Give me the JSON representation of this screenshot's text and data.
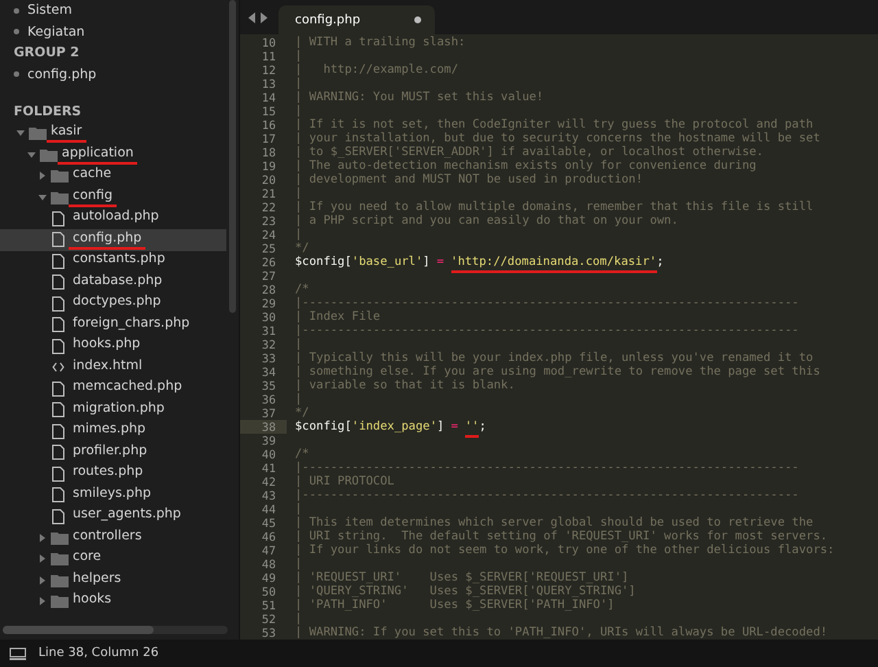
{
  "open_files": [
    {
      "kind": "item",
      "label": "Sistem"
    },
    {
      "kind": "item",
      "label": "Kegiatan"
    },
    {
      "kind": "header",
      "label": "GROUP 2"
    },
    {
      "kind": "item",
      "label": "config.php"
    }
  ],
  "folders": {
    "title": "FOLDERS",
    "tree": [
      {
        "kind": "folder",
        "label": "kasir",
        "expanded": true,
        "underlined": true,
        "selected": false,
        "children": [
          {
            "kind": "folder",
            "label": "application",
            "expanded": true,
            "underlined": true,
            "selected": false,
            "children": [
              {
                "kind": "folder",
                "label": "cache",
                "expanded": false,
                "underlined": false,
                "selected": false
              },
              {
                "kind": "folder",
                "label": "config",
                "expanded": true,
                "underlined": true,
                "selected": false,
                "children": [
                  {
                    "kind": "file",
                    "label": "autoload.php",
                    "underlined": false,
                    "selected": false
                  },
                  {
                    "kind": "file",
                    "label": "config.php",
                    "underlined": true,
                    "selected": true
                  },
                  {
                    "kind": "file",
                    "label": "constants.php",
                    "underlined": false,
                    "selected": false
                  },
                  {
                    "kind": "file",
                    "label": "database.php",
                    "underlined": false,
                    "selected": false
                  },
                  {
                    "kind": "file",
                    "label": "doctypes.php",
                    "underlined": false,
                    "selected": false
                  },
                  {
                    "kind": "file",
                    "label": "foreign_chars.php",
                    "underlined": false,
                    "selected": false
                  },
                  {
                    "kind": "file",
                    "label": "hooks.php",
                    "underlined": false,
                    "selected": false
                  },
                  {
                    "kind": "markup",
                    "label": "index.html",
                    "underlined": false,
                    "selected": false
                  },
                  {
                    "kind": "file",
                    "label": "memcached.php",
                    "underlined": false,
                    "selected": false
                  },
                  {
                    "kind": "file",
                    "label": "migration.php",
                    "underlined": false,
                    "selected": false
                  },
                  {
                    "kind": "file",
                    "label": "mimes.php",
                    "underlined": false,
                    "selected": false
                  },
                  {
                    "kind": "file",
                    "label": "profiler.php",
                    "underlined": false,
                    "selected": false
                  },
                  {
                    "kind": "file",
                    "label": "routes.php",
                    "underlined": false,
                    "selected": false
                  },
                  {
                    "kind": "file",
                    "label": "smileys.php",
                    "underlined": false,
                    "selected": false
                  },
                  {
                    "kind": "file",
                    "label": "user_agents.php",
                    "underlined": false,
                    "selected": false
                  }
                ]
              },
              {
                "kind": "folder",
                "label": "controllers",
                "expanded": false,
                "underlined": false,
                "selected": false
              },
              {
                "kind": "folder",
                "label": "core",
                "expanded": false,
                "underlined": false,
                "selected": false
              },
              {
                "kind": "folder",
                "label": "helpers",
                "expanded": false,
                "underlined": false,
                "selected": false
              },
              {
                "kind": "folder",
                "label": "hooks",
                "expanded": false,
                "underlined": false,
                "selected": false
              }
            ]
          }
        ]
      }
    ]
  },
  "tab": {
    "label": "config.php",
    "modified": true
  },
  "editor": {
    "lines": [
      {
        "number": "10",
        "current": false,
        "tokens": [
          {
            "kind": "comment",
            "text": "| WITH a trailing slash:"
          }
        ]
      },
      {
        "number": "11",
        "current": false,
        "tokens": [
          {
            "kind": "comment",
            "text": "|"
          }
        ]
      },
      {
        "number": "12",
        "current": false,
        "tokens": [
          {
            "kind": "comment",
            "text": "|   http://example.com/"
          }
        ]
      },
      {
        "number": "13",
        "current": false,
        "tokens": [
          {
            "kind": "comment",
            "text": "|"
          }
        ]
      },
      {
        "number": "14",
        "current": false,
        "tokens": [
          {
            "kind": "comment",
            "text": "| WARNING: You MUST set this value!"
          }
        ]
      },
      {
        "number": "15",
        "current": false,
        "tokens": [
          {
            "kind": "comment",
            "text": "|"
          }
        ]
      },
      {
        "number": "16",
        "current": false,
        "tokens": [
          {
            "kind": "comment",
            "text": "| If it is not set, then CodeIgniter will try guess the protocol and path"
          }
        ]
      },
      {
        "number": "17",
        "current": false,
        "tokens": [
          {
            "kind": "comment",
            "text": "| your installation, but due to security concerns the hostname will be set"
          }
        ]
      },
      {
        "number": "18",
        "current": false,
        "tokens": [
          {
            "kind": "comment",
            "text": "| to $_SERVER['SERVER_ADDR'] if available, or localhost otherwise."
          }
        ]
      },
      {
        "number": "19",
        "current": false,
        "tokens": [
          {
            "kind": "comment",
            "text": "| The auto-detection mechanism exists only for convenience during"
          }
        ]
      },
      {
        "number": "20",
        "current": false,
        "tokens": [
          {
            "kind": "comment",
            "text": "| development and MUST NOT be used in production!"
          }
        ]
      },
      {
        "number": "21",
        "current": false,
        "tokens": [
          {
            "kind": "comment",
            "text": "|"
          }
        ]
      },
      {
        "number": "22",
        "current": false,
        "tokens": [
          {
            "kind": "comment",
            "text": "| If you need to allow multiple domains, remember that this file is still"
          }
        ]
      },
      {
        "number": "23",
        "current": false,
        "tokens": [
          {
            "kind": "comment",
            "text": "| a PHP script and you can easily do that on your own."
          }
        ]
      },
      {
        "number": "24",
        "current": false,
        "tokens": [
          {
            "kind": "comment",
            "text": "|"
          }
        ]
      },
      {
        "number": "25",
        "current": false,
        "tokens": [
          {
            "kind": "comment",
            "text": "*/"
          }
        ]
      },
      {
        "number": "26",
        "current": false,
        "tokens": [
          {
            "kind": "variable",
            "text": "$config",
            "underlined": false
          },
          {
            "kind": "plain",
            "text": "[",
            "underlined": false
          },
          {
            "kind": "string",
            "text": "'base_url'",
            "underlined": false
          },
          {
            "kind": "plain",
            "text": "]",
            "underlined": false
          },
          {
            "kind": "operator",
            "text": "=",
            "underlined": false
          },
          {
            "kind": "string",
            "text": "'http://domainanda.com/kasir'",
            "underlined": true
          },
          {
            "kind": "plain",
            "text": ";",
            "underlined": false
          }
        ]
      },
      {
        "number": "27",
        "current": false
      },
      {
        "number": "28",
        "current": false,
        "tokens": [
          {
            "kind": "comment",
            "text": "/*"
          }
        ]
      },
      {
        "number": "29",
        "current": false,
        "tokens": [
          {
            "kind": "comment",
            "text": "|----------------------------------------------------------------------"
          }
        ]
      },
      {
        "number": "30",
        "current": false,
        "tokens": [
          {
            "kind": "comment",
            "text": "| Index File"
          }
        ]
      },
      {
        "number": "31",
        "current": false,
        "tokens": [
          {
            "kind": "comment",
            "text": "|----------------------------------------------------------------------"
          }
        ]
      },
      {
        "number": "32",
        "current": false,
        "tokens": [
          {
            "kind": "comment",
            "text": "|"
          }
        ]
      },
      {
        "number": "33",
        "current": false,
        "tokens": [
          {
            "kind": "comment",
            "text": "| Typically this will be your index.php file, unless you've renamed it to"
          }
        ]
      },
      {
        "number": "34",
        "current": false,
        "tokens": [
          {
            "kind": "comment",
            "text": "| something else. If you are using mod_rewrite to remove the page set this"
          }
        ]
      },
      {
        "number": "35",
        "current": false,
        "tokens": [
          {
            "kind": "comment",
            "text": "| variable so that it is blank."
          }
        ]
      },
      {
        "number": "36",
        "current": false,
        "tokens": [
          {
            "kind": "comment",
            "text": "|"
          }
        ]
      },
      {
        "number": "37",
        "current": false,
        "tokens": [
          {
            "kind": "comment",
            "text": "*/"
          }
        ]
      },
      {
        "number": "38",
        "current": true,
        "tokens": [
          {
            "kind": "variable",
            "text": "$config",
            "underlined": false
          },
          {
            "kind": "plain",
            "text": "[",
            "underlined": false
          },
          {
            "kind": "string",
            "text": "'index_page'",
            "underlined": false
          },
          {
            "kind": "plain",
            "text": "]",
            "underlined": false
          },
          {
            "kind": "operator",
            "text": "=",
            "underlined": false
          },
          {
            "kind": "string",
            "text": "''",
            "underlined": true
          },
          {
            "kind": "plain",
            "text": ";",
            "underlined": false
          }
        ]
      },
      {
        "number": "39",
        "current": false
      },
      {
        "number": "40",
        "current": false,
        "tokens": [
          {
            "kind": "comment",
            "text": "/*"
          }
        ]
      },
      {
        "number": "41",
        "current": false,
        "tokens": [
          {
            "kind": "comment",
            "text": "|----------------------------------------------------------------------"
          }
        ]
      },
      {
        "number": "42",
        "current": false,
        "tokens": [
          {
            "kind": "comment",
            "text": "| URI PROTOCOL"
          }
        ]
      },
      {
        "number": "43",
        "current": false,
        "tokens": [
          {
            "kind": "comment",
            "text": "|----------------------------------------------------------------------"
          }
        ]
      },
      {
        "number": "44",
        "current": false,
        "tokens": [
          {
            "kind": "comment",
            "text": "|"
          }
        ]
      },
      {
        "number": "45",
        "current": false,
        "tokens": [
          {
            "kind": "comment",
            "text": "| This item determines which server global should be used to retrieve the"
          }
        ]
      },
      {
        "number": "46",
        "current": false,
        "tokens": [
          {
            "kind": "comment",
            "text": "| URI string.  The default setting of 'REQUEST_URI' works for most servers."
          }
        ]
      },
      {
        "number": "47",
        "current": false,
        "tokens": [
          {
            "kind": "comment",
            "text": "| If your links do not seem to work, try one of the other delicious flavors:"
          }
        ]
      },
      {
        "number": "48",
        "current": false,
        "tokens": [
          {
            "kind": "comment",
            "text": "|"
          }
        ]
      },
      {
        "number": "49",
        "current": false,
        "tokens": [
          {
            "kind": "comment",
            "text": "| 'REQUEST_URI'    Uses $_SERVER['REQUEST_URI']"
          }
        ]
      },
      {
        "number": "50",
        "current": false,
        "tokens": [
          {
            "kind": "comment",
            "text": "| 'QUERY_STRING'   Uses $_SERVER['QUERY_STRING']"
          }
        ]
      },
      {
        "number": "51",
        "current": false,
        "tokens": [
          {
            "kind": "comment",
            "text": "| 'PATH_INFO'      Uses $_SERVER['PATH_INFO']"
          }
        ]
      },
      {
        "number": "52",
        "current": false,
        "tokens": [
          {
            "kind": "comment",
            "text": "|"
          }
        ]
      },
      {
        "number": "53",
        "current": false,
        "tokens": [
          {
            "kind": "comment",
            "text": "| WARNING: If you set this to 'PATH_INFO', URIs will always be URL-decoded!"
          }
        ]
      }
    ]
  },
  "status_bar": {
    "position": "Line 38, Column 26"
  }
}
